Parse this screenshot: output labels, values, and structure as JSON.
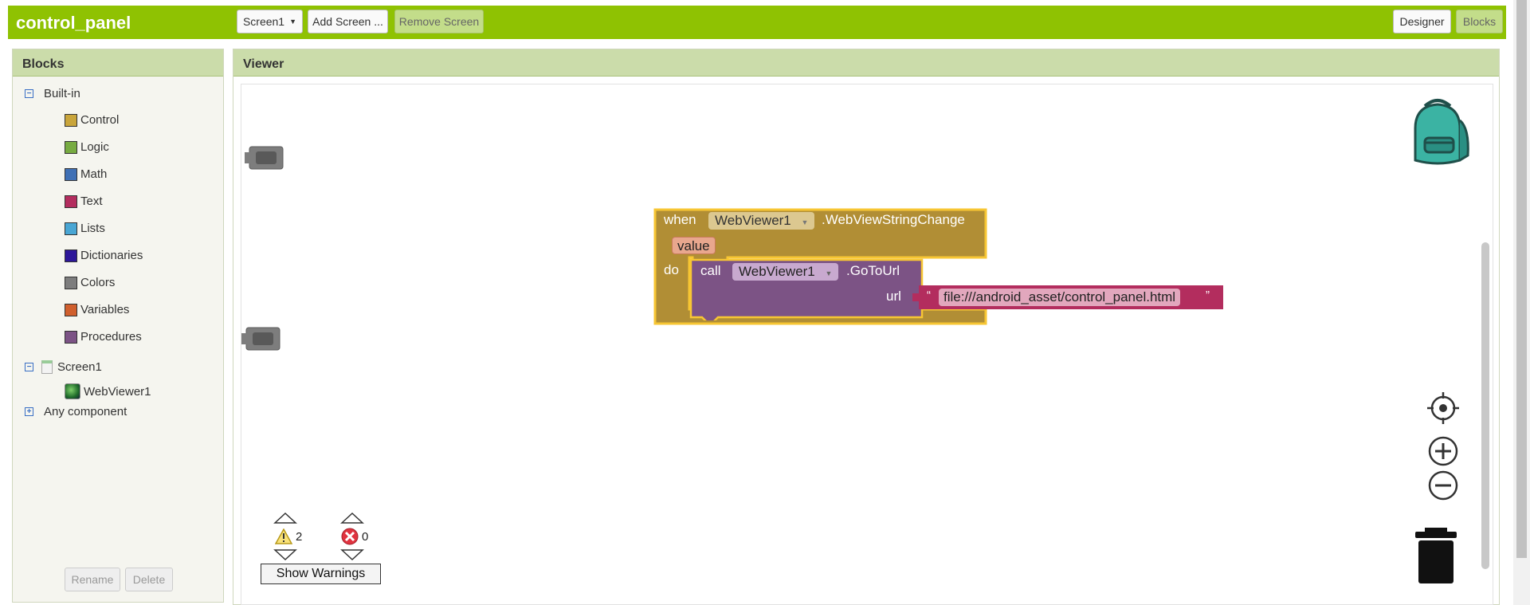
{
  "app": {
    "title": "control_panel"
  },
  "toolbar": {
    "screen_select": "Screen1",
    "add_screen": "Add Screen ...",
    "remove_screen": "Remove Screen",
    "designer": "Designer",
    "blocks": "Blocks"
  },
  "blocks_panel": {
    "header": "Blocks",
    "builtin_label": "Built-in",
    "builtin_items": [
      {
        "label": "Control",
        "color": "#c9a53b"
      },
      {
        "label": "Logic",
        "color": "#77ab41"
      },
      {
        "label": "Math",
        "color": "#3f70b5"
      },
      {
        "label": "Text",
        "color": "#b32d5e"
      },
      {
        "label": "Lists",
        "color": "#49a6d4"
      },
      {
        "label": "Dictionaries",
        "color": "#2d1799"
      },
      {
        "label": "Colors",
        "color": "#7d7d7d"
      },
      {
        "label": "Variables",
        "color": "#d05f2d"
      },
      {
        "label": "Procedures",
        "color": "#7c5385"
      }
    ],
    "screen_label": "Screen1",
    "component_label": "WebViewer1",
    "any_component": "Any component",
    "rename": "Rename",
    "delete": "Delete"
  },
  "viewer": {
    "header": "Viewer",
    "event_block": {
      "when": "when",
      "component": "WebViewer1",
      "event": ".WebViewStringChange",
      "param": "value",
      "do": "do"
    },
    "call_block": {
      "call": "call",
      "component": "WebViewer1",
      "method": ".GoToUrl",
      "arg": "url"
    },
    "text_block": {
      "open_quote": "“",
      "value": "file:///android_asset/control_panel.html",
      "close_quote": "”"
    },
    "warnings": {
      "count": "2",
      "icon": "warning-triangle-icon"
    },
    "errors": {
      "count": "0",
      "icon": "error-circle-icon"
    },
    "show_warnings": "Show Warnings"
  },
  "colors": {
    "topbar": "#8fc202",
    "event_block": "#b18e35",
    "call_block": "#7c5385",
    "text_block": "#b32d5e",
    "selection": "#f7c633"
  }
}
